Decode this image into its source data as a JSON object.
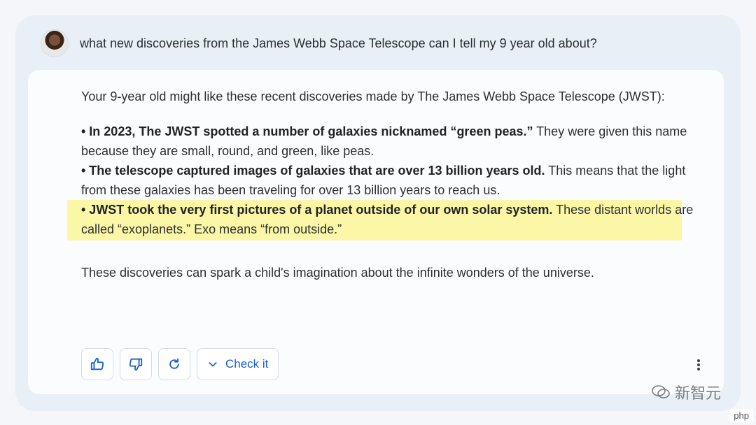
{
  "prompt": {
    "text": "what new discoveries from the James Webb Space Telescope can I tell my 9 year old about?"
  },
  "response": {
    "intro": "Your 9-year old might like these recent discoveries made by The James Webb Space Telescope (JWST):",
    "bullets": [
      {
        "bold": "• In 2023, The JWST spotted a number of galaxies nicknamed “green peas.”",
        "rest": " They were given this name because they are small, round, and green, like peas."
      },
      {
        "bold": "• The telescope captured images of galaxies that are over 13 billion years old.",
        "rest": " This means that the light from these galaxies has been traveling for over 13 billion years to reach us."
      },
      {
        "bold": "• JWST took the very first pictures of a planet outside of our own solar system.",
        "rest": " These distant worlds are called “exoplanets.” Exo means “from outside.”"
      }
    ],
    "conclusion": "These discoveries can spark a child's imagination about the infinite wonders of the universe."
  },
  "actions": {
    "thumbs_up_icon": "thumbs-up-icon",
    "thumbs_down_icon": "thumbs-down-icon",
    "regenerate_icon": "refresh-icon",
    "check_it_label": "Check it",
    "more_icon": "more-vertical-icon"
  },
  "colors": {
    "highlight": "#fbf7a6",
    "accent": "#1a5fd0"
  },
  "watermark": {
    "text": "新智元",
    "badge": "php"
  }
}
